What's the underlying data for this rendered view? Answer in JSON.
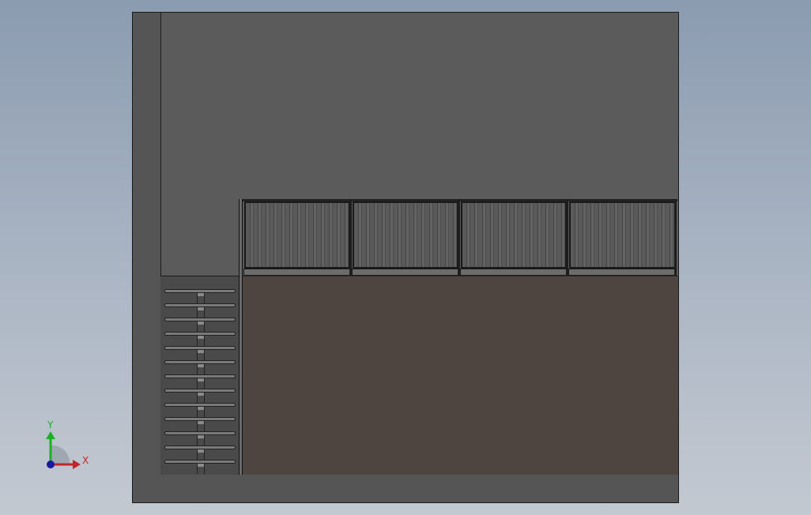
{
  "viewport": {
    "background_top": "#8b9bb0",
    "background_bottom": "#c3c9d1"
  },
  "model": {
    "wall_color": "#5b5b5b",
    "floor_color": "#4f4540",
    "railing_panel_count": 4,
    "stair_tread_count": 13
  },
  "triad": {
    "y_label": "Y",
    "x_label": "X",
    "y_color": "#1fae2a",
    "x_color": "#c0262a",
    "z_color": "#1a1aa0",
    "icon": "coordinate-triad-icon"
  }
}
